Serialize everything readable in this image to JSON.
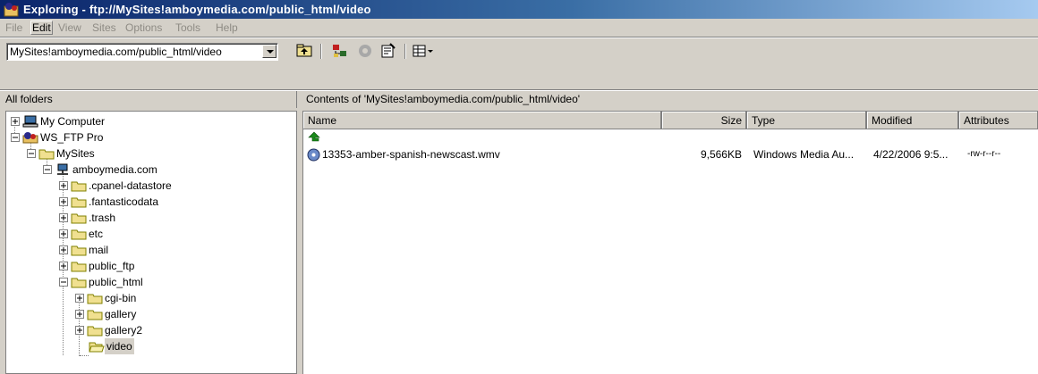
{
  "window": {
    "title": "Exploring - ftp://MySites!amboymedia.com/public_html/video"
  },
  "menu": {
    "items": [
      {
        "label": "File"
      },
      {
        "label": "Edit"
      },
      {
        "label": "View"
      },
      {
        "label": "Sites"
      },
      {
        "label": "Options"
      },
      {
        "label": "Tools"
      },
      {
        "label": "Help"
      }
    ]
  },
  "address": {
    "value": "MySites!amboymedia.com/public_html/video"
  },
  "toolbar": {
    "icons": [
      "up-folder-icon",
      "connect-icon",
      "stop-icon",
      "properties-icon",
      "view-mode-icon"
    ]
  },
  "left_pane": {
    "header": "All folders",
    "tree": [
      {
        "label": "My Computer",
        "icon": "computer-icon"
      },
      {
        "label": "WS_FTP Pro",
        "icon": "wsftp-icon"
      },
      {
        "label": "MySites",
        "icon": "folder-icon"
      },
      {
        "label": "amboymedia.com",
        "icon": "network-server-icon"
      },
      {
        "label": ".cpanel-datastore",
        "icon": "folder-icon"
      },
      {
        "label": ".fantasticodata",
        "icon": "folder-icon"
      },
      {
        "label": ".trash",
        "icon": "folder-icon"
      },
      {
        "label": "etc",
        "icon": "folder-icon"
      },
      {
        "label": "mail",
        "icon": "folder-icon"
      },
      {
        "label": "public_ftp",
        "icon": "folder-icon"
      },
      {
        "label": "public_html",
        "icon": "folder-icon"
      },
      {
        "label": "cgi-bin",
        "icon": "folder-icon"
      },
      {
        "label": "gallery",
        "icon": "folder-icon"
      },
      {
        "label": "gallery2",
        "icon": "folder-icon"
      },
      {
        "label": "video",
        "icon": "open-folder-icon"
      }
    ]
  },
  "right_pane": {
    "header": "Contents of 'MySites!amboymedia.com/public_html/video'",
    "columns": [
      "Name",
      "Size",
      "Type",
      "Modified",
      "Attributes"
    ],
    "files": [
      {
        "name": "13353-amber-spanish-newscast.wmv",
        "size": "9,566KB",
        "type": "Windows Media Au...",
        "modified": "4/22/2006 9:5...",
        "attributes": "-rw-r--r--",
        "icon": "media-file-icon"
      }
    ],
    "up_icon": "up-arrow-icon"
  },
  "colors": {
    "title_gradient_start": "#0a246a",
    "title_gradient_end": "#a6caf0",
    "chrome": "#d4d0c8",
    "up_arrow": "#1a8a1a"
  }
}
